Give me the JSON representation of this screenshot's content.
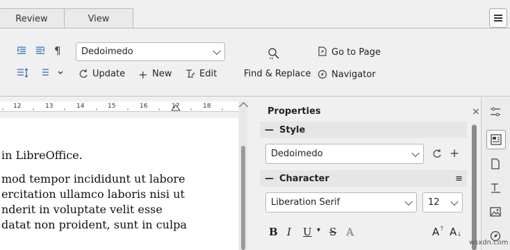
{
  "tabs": {
    "review": "Review",
    "view": "View"
  },
  "toolbar": {
    "paragraph_mark": "¶",
    "style_value": "Dedoimedo",
    "update": "Update",
    "new": "New",
    "edit": "Edit",
    "find_replace": "Find & Replace",
    "goto_page": "Go to Page",
    "navigator": "Navigator"
  },
  "ruler": {
    "ticks": [
      "12",
      "13",
      "14",
      "15",
      "16",
      "17",
      "18"
    ]
  },
  "document": {
    "lines": [
      "in LibreOffice.",
      "mod tempor incididunt ut labore",
      "ercitation ullamco laboris nisi ut",
      "nderit in voluptate velit esse",
      "datat non proident, sunt in culpa"
    ]
  },
  "sidebar": {
    "title": "Properties",
    "close": "×",
    "style_section": "Style",
    "style_value": "Dedoimedo",
    "character_section": "Character",
    "font_value": "Liberation Serif",
    "size_value": "12",
    "bold": "B",
    "italic": "I",
    "underline": "U",
    "strike": "S",
    "shadow": "A",
    "grow": "A",
    "shrink": "A"
  },
  "watermark": "wsxdn.com"
}
